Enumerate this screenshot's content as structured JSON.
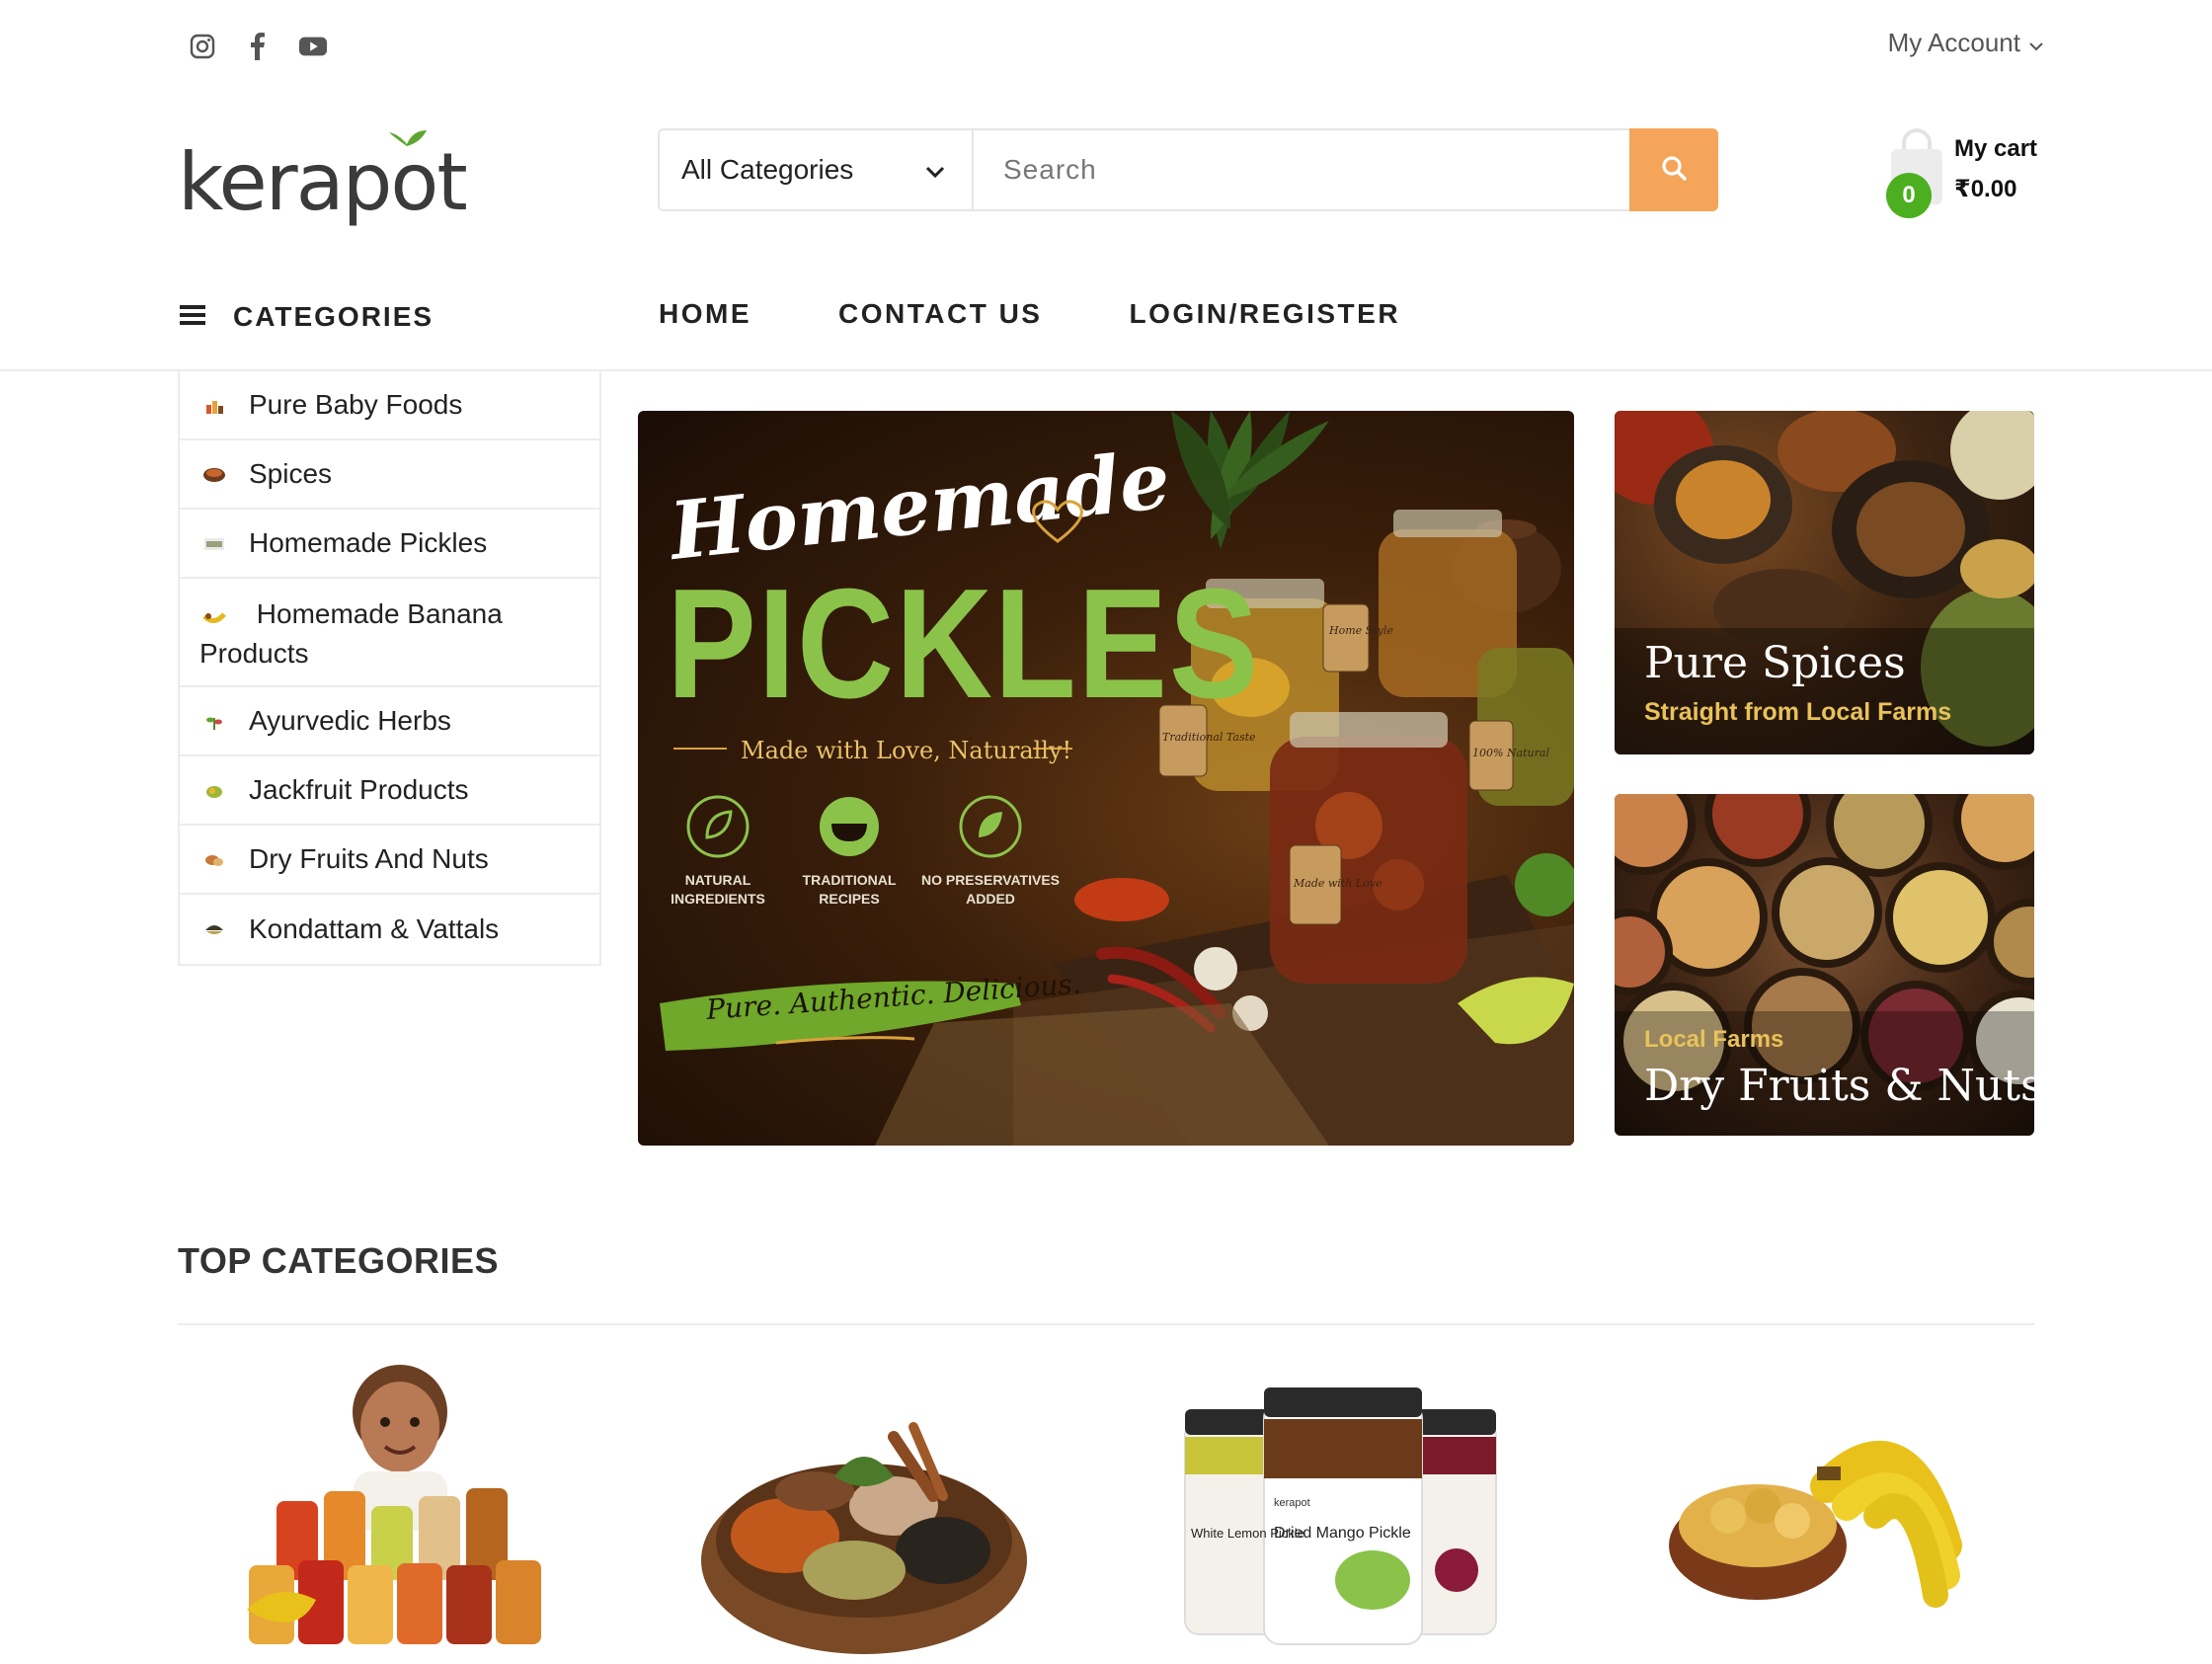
{
  "header": {
    "social": [
      "instagram-icon",
      "facebook-icon",
      "youtube-icon"
    ],
    "account_label": "My Account",
    "logo_text": "kerapot"
  },
  "search": {
    "category_selected": "All Categories",
    "placeholder": "Search"
  },
  "cart": {
    "label": "My cart",
    "total": "₹0.00",
    "count": "0"
  },
  "nav": {
    "categories_label": "CATEGORIES",
    "links": [
      "HOME",
      "CONTACT US",
      "LOGIN/REGISTER"
    ]
  },
  "sidebar": {
    "items": [
      {
        "label": "Pure Baby Foods",
        "icon": "baby-food-icon"
      },
      {
        "label": "Spices",
        "icon": "spice-bowl-icon"
      },
      {
        "label": "Homemade Pickles",
        "icon": "pickle-jar-icon"
      },
      {
        "label": "Homemade Banana Products",
        "icon": "banana-icon"
      },
      {
        "label": "Ayurvedic Herbs",
        "icon": "herb-icon"
      },
      {
        "label": "Jackfruit Products",
        "icon": "jackfruit-icon"
      },
      {
        "label": "Dry Fruits And Nuts",
        "icon": "nuts-icon"
      },
      {
        "label": "Kondattam & Vattals",
        "icon": "kondattam-icon"
      }
    ]
  },
  "hero": {
    "script_title": "Homemade",
    "title": "PICKLES",
    "tagline": "Made with Love, Naturally!",
    "features": [
      {
        "line1": "NATURAL",
        "line2": "INGREDIENTS"
      },
      {
        "line1": "TRADITIONAL",
        "line2": "RECIPES"
      },
      {
        "line1": "NO PRESERVATIVES",
        "line2": "ADDED"
      }
    ],
    "slogan": "Pure. Authentic. Delicious.",
    "jar_tags": [
      "Home Style",
      "Traditional Taste",
      "100% Natural",
      "Made with Love"
    ]
  },
  "promos": [
    {
      "title": "Pure Spices",
      "subtitle": "Straight from Local Farms"
    },
    {
      "pretitle": "Local Farms",
      "title": "Dry Fruits & Nuts"
    }
  ],
  "top_categories": {
    "title": "TOP CATEGORIES",
    "jar_labels": {
      "brand": "kerapot",
      "front": "Dried Mango Pickle",
      "left": "White Lemon Pickle"
    }
  },
  "colors": {
    "accent_orange": "#f5a55a",
    "cart_badge_green": "#4caf1f",
    "hero_green": "#8bc34a"
  }
}
